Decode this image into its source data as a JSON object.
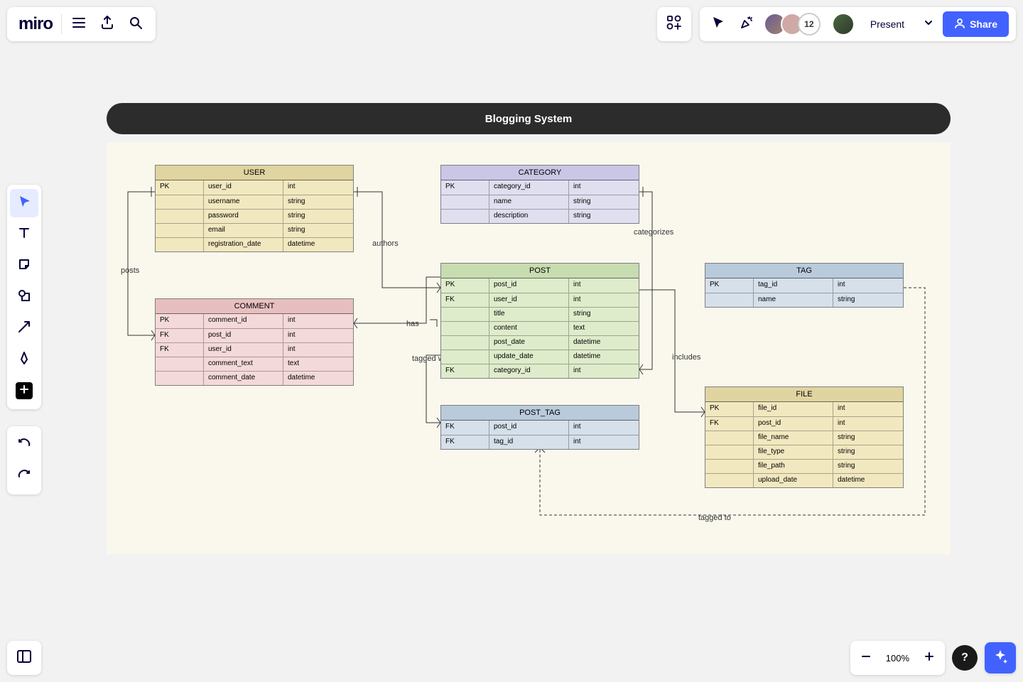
{
  "app": {
    "logo": "miro"
  },
  "header": {
    "present": "Present",
    "share": "Share",
    "collab_count": "12"
  },
  "zoom": {
    "level": "100%"
  },
  "board": {
    "title": "Blogging System"
  },
  "entities": {
    "user": {
      "name": "USER",
      "rows": [
        {
          "key": "PK",
          "field": "user_id",
          "type": "int"
        },
        {
          "key": "",
          "field": "username",
          "type": "string"
        },
        {
          "key": "",
          "field": "password",
          "type": "string"
        },
        {
          "key": "",
          "field": "email",
          "type": "string"
        },
        {
          "key": "",
          "field": "registration_date",
          "type": "datetime"
        }
      ]
    },
    "comment": {
      "name": "COMMENT",
      "rows": [
        {
          "key": "PK",
          "field": "comment_id",
          "type": "int"
        },
        {
          "key": "FK",
          "field": "post_id",
          "type": "int"
        },
        {
          "key": "FK",
          "field": "user_id",
          "type": "int"
        },
        {
          "key": "",
          "field": "comment_text",
          "type": "text"
        },
        {
          "key": "",
          "field": "comment_date",
          "type": "datetime"
        }
      ]
    },
    "category": {
      "name": "CATEGORY",
      "rows": [
        {
          "key": "PK",
          "field": "category_id",
          "type": "int"
        },
        {
          "key": "",
          "field": "name",
          "type": "string"
        },
        {
          "key": "",
          "field": "description",
          "type": "string"
        }
      ]
    },
    "post": {
      "name": "POST",
      "rows": [
        {
          "key": "PK",
          "field": "post_id",
          "type": "int"
        },
        {
          "key": "FK",
          "field": "user_id",
          "type": "int"
        },
        {
          "key": "",
          "field": "title",
          "type": "string"
        },
        {
          "key": "",
          "field": "content",
          "type": "text"
        },
        {
          "key": "",
          "field": "post_date",
          "type": "datetime"
        },
        {
          "key": "",
          "field": "update_date",
          "type": "datetime"
        },
        {
          "key": "FK",
          "field": "category_id",
          "type": "int"
        }
      ]
    },
    "posttag": {
      "name": "POST_TAG",
      "rows": [
        {
          "key": "FK",
          "field": "post_id",
          "type": "int"
        },
        {
          "key": "FK",
          "field": "tag_id",
          "type": "int"
        }
      ]
    },
    "tag": {
      "name": "TAG",
      "rows": [
        {
          "key": "PK",
          "field": "tag_id",
          "type": "int"
        },
        {
          "key": "",
          "field": "name",
          "type": "string"
        }
      ]
    },
    "file": {
      "name": "FILE",
      "rows": [
        {
          "key": "PK",
          "field": "file_id",
          "type": "int"
        },
        {
          "key": "FK",
          "field": "post_id",
          "type": "int"
        },
        {
          "key": "",
          "field": "file_name",
          "type": "string"
        },
        {
          "key": "",
          "field": "file_type",
          "type": "string"
        },
        {
          "key": "",
          "field": "file_path",
          "type": "string"
        },
        {
          "key": "",
          "field": "upload_date",
          "type": "datetime"
        }
      ]
    }
  },
  "relations": {
    "posts": "posts",
    "authors": "authors",
    "has": "has",
    "categorizes": "categorizes",
    "includes": "includes",
    "tagged_with": "tagged with",
    "tagged_to": "tagged to"
  }
}
